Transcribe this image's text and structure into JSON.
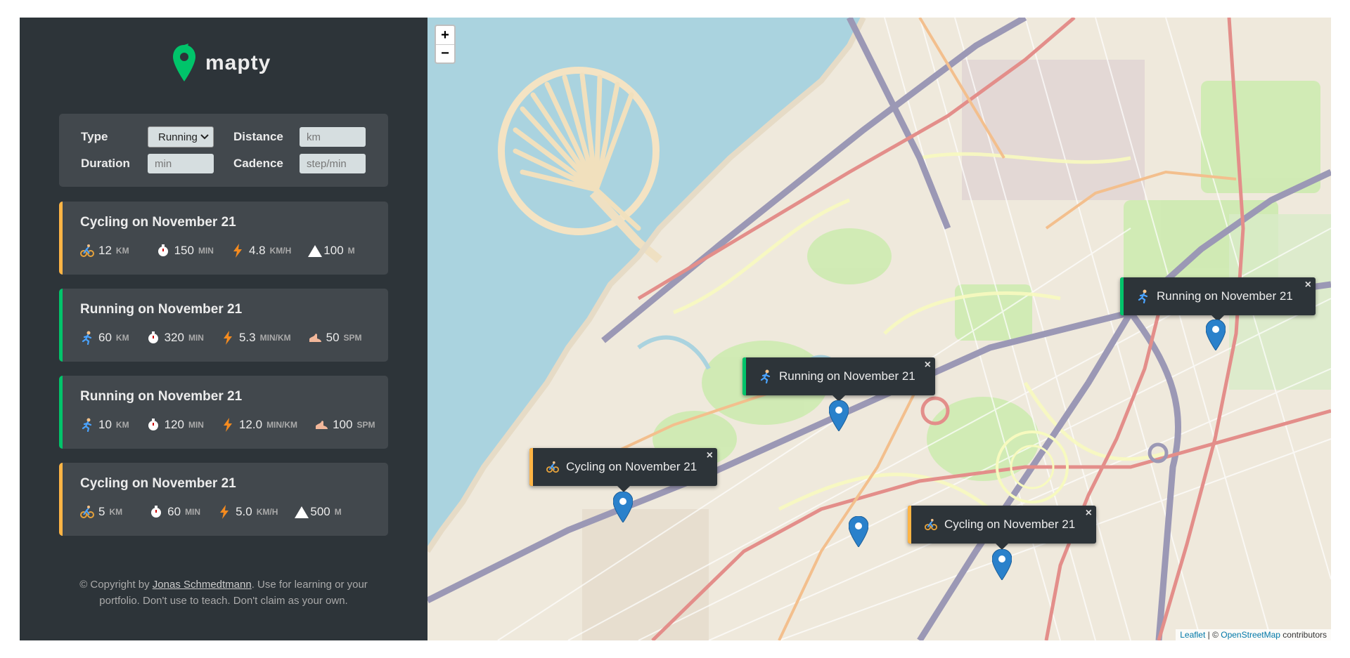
{
  "app": {
    "name": "mapty"
  },
  "form": {
    "type_label": "Type",
    "type_value": "Running",
    "distance_label": "Distance",
    "distance_placeholder": "km",
    "duration_label": "Duration",
    "duration_placeholder": "min",
    "cadence_label": "Cadence",
    "cadence_placeholder": "step/min"
  },
  "workouts": [
    {
      "type": "cycling",
      "title": "Cycling on November 21",
      "distance": "12",
      "distance_unit": "km",
      "duration": "150",
      "duration_unit": "min",
      "speed": "4.8",
      "speed_unit": "km/h",
      "extra": "100",
      "extra_unit": "m"
    },
    {
      "type": "running",
      "title": "Running on November 21",
      "distance": "60",
      "distance_unit": "km",
      "duration": "320",
      "duration_unit": "min",
      "speed": "5.3",
      "speed_unit": "min/km",
      "extra": "50",
      "extra_unit": "spm"
    },
    {
      "type": "running",
      "title": "Running on November 21",
      "distance": "10",
      "distance_unit": "km",
      "duration": "120",
      "duration_unit": "min",
      "speed": "12.0",
      "speed_unit": "min/km",
      "extra": "100",
      "extra_unit": "spm"
    },
    {
      "type": "cycling",
      "title": "Cycling on November 21",
      "distance": "5",
      "distance_unit": "km",
      "duration": "60",
      "duration_unit": "min",
      "speed": "5.0",
      "speed_unit": "km/h",
      "extra": "500",
      "extra_unit": "m"
    }
  ],
  "copyright": {
    "prefix": "© Copyright by ",
    "author": "Jonas Schmedtmann",
    "suffix": ". Use for learning or your portfolio. Don't use to teach. Don't claim as your own."
  },
  "map": {
    "zoom_in": "+",
    "zoom_out": "−",
    "popups": [
      {
        "type": "running",
        "text": "Running on November 21",
        "close": "×"
      },
      {
        "type": "running",
        "text": "Running on November 21",
        "close": "×"
      },
      {
        "type": "cycling",
        "text": "Cycling on November 21",
        "close": "×"
      },
      {
        "type": "cycling",
        "text": "Cycling on November 21",
        "close": "×"
      }
    ],
    "attribution": {
      "leaflet": "Leaflet",
      "separator": " | © ",
      "osm": "OpenStreetMap",
      "suffix": " contributors"
    }
  },
  "colors": {
    "cycling": "#ffb545",
    "running": "#00c46a",
    "sidebar_bg": "#2d3439",
    "card_bg": "#42484d",
    "marker": "#2a81cb",
    "sea": "#aad3df"
  },
  "icons": {
    "cycling": "cyclist-icon",
    "running": "runner-icon",
    "duration": "stopwatch-icon",
    "speed": "lightning-icon",
    "elevation": "mountain-icon",
    "cadence": "footprint-icon"
  }
}
